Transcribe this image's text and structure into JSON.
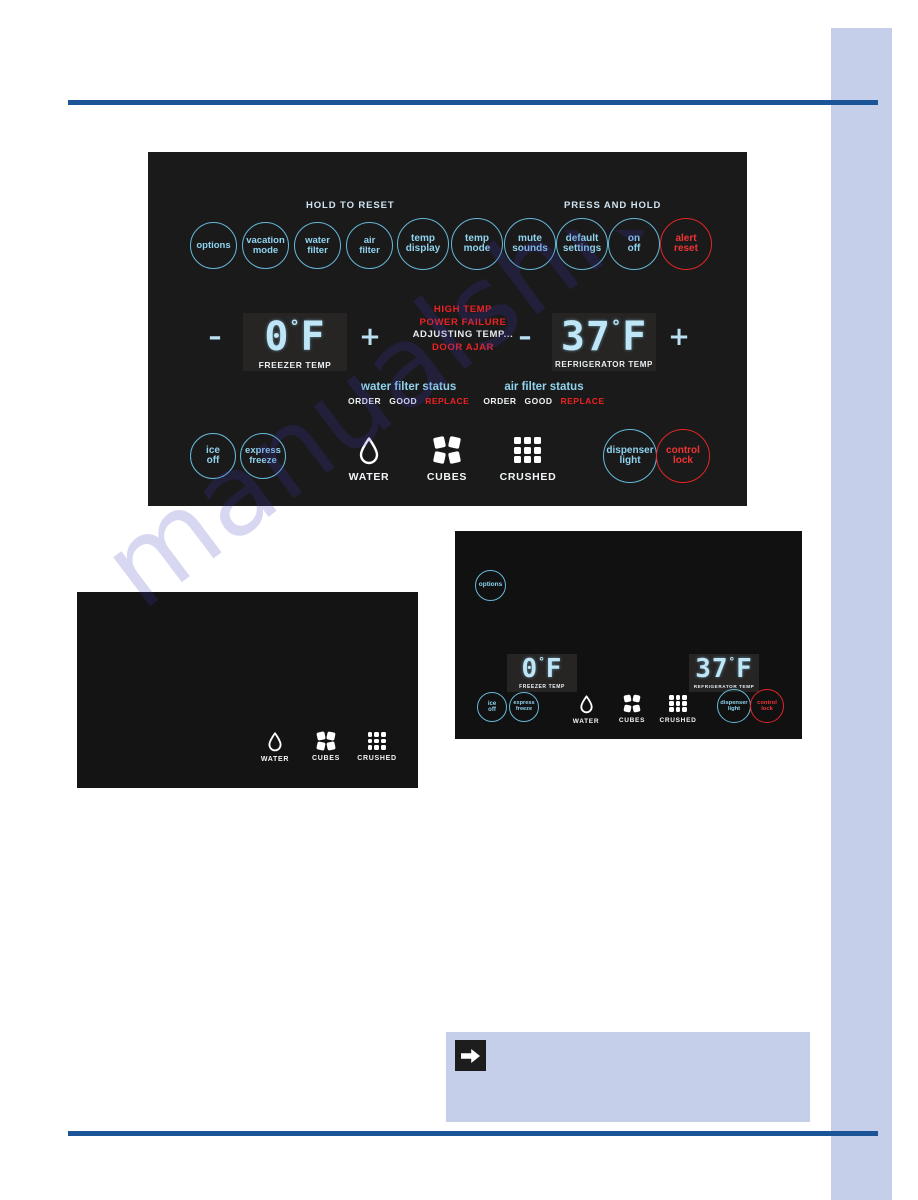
{
  "page": {
    "accent_rule_color": "#1b5497",
    "side_tab_color": "#c6cfe9",
    "watermark_text": "manualshive.com"
  },
  "main_panel": {
    "background_color": "#1b1a1a",
    "hints": {
      "hold_to_reset": "HOLD TO RESET",
      "press_and_hold": "PRESS AND HOLD"
    },
    "top_buttons": [
      {
        "id": "options",
        "lines": [
          "options"
        ],
        "color": "#8fd3ee",
        "style": "blue"
      },
      {
        "id": "vacation-mode",
        "lines": [
          "vacation",
          "mode"
        ],
        "color": "#8fd3ee",
        "style": "blue"
      },
      {
        "id": "water-filter",
        "lines": [
          "water",
          "filter"
        ],
        "color": "#8fd3ee",
        "style": "blue"
      },
      {
        "id": "air-filter",
        "lines": [
          "air",
          "filter"
        ],
        "color": "#8fd3ee",
        "style": "blue"
      },
      {
        "id": "temp-display",
        "lines": [
          "temp",
          "display"
        ],
        "color": "#8fd3ee",
        "style": "blue"
      },
      {
        "id": "temp-mode",
        "lines": [
          "temp",
          "mode"
        ],
        "color": "#8fd3ee",
        "style": "blue"
      },
      {
        "id": "mute-sounds",
        "lines": [
          "mute",
          "sounds"
        ],
        "color": "#8fd3ee",
        "style": "blue"
      },
      {
        "id": "default-settings",
        "lines": [
          "default",
          "settings"
        ],
        "color": "#8fd3ee",
        "style": "blue"
      },
      {
        "id": "on-off",
        "lines": [
          "on",
          "off"
        ],
        "color": "#8fd3ee",
        "style": "blue"
      },
      {
        "id": "alert-reset",
        "lines": [
          "alert",
          "reset"
        ],
        "color": "#f03434",
        "style": "red"
      }
    ],
    "freezer": {
      "minus": "–",
      "plus": "+",
      "value": "0",
      "degree": "°",
      "unit": "F",
      "caption": "FREEZER TEMP"
    },
    "refrigerator": {
      "minus": "–",
      "plus": "+",
      "value": "37",
      "degree": "°",
      "unit": "F",
      "caption": "REFRIGERATOR TEMP"
    },
    "alerts": [
      {
        "text": "HIGH TEMP",
        "color": "#ee2222",
        "tone": "red"
      },
      {
        "text": "POWER FAILURE",
        "color": "#ee2222",
        "tone": "red"
      },
      {
        "text": "ADJUSTING TEMP...",
        "color": "#e8eef2",
        "tone": "white"
      },
      {
        "text": "DOOR AJAR",
        "color": "#ee2222",
        "tone": "red"
      }
    ],
    "filter_status": [
      {
        "id": "water-filter-status",
        "title": "water filter status",
        "states": [
          {
            "label": "ORDER",
            "tone": "white"
          },
          {
            "label": "GOOD",
            "tone": "white"
          },
          {
            "label": "REPLACE",
            "tone": "red"
          }
        ]
      },
      {
        "id": "air-filter-status",
        "title": "air filter status",
        "states": [
          {
            "label": "ORDER",
            "tone": "white"
          },
          {
            "label": "GOOD",
            "tone": "white"
          },
          {
            "label": "REPLACE",
            "tone": "red"
          }
        ]
      }
    ],
    "bottom_buttons": [
      {
        "id": "ice-off",
        "lines": [
          "ice",
          "off"
        ],
        "style": "blue"
      },
      {
        "id": "express-freeze",
        "lines": [
          "express",
          "freeze"
        ],
        "style": "blue"
      },
      {
        "id": "dispenser-light",
        "lines": [
          "dispenser",
          "light"
        ],
        "style": "blue"
      },
      {
        "id": "control-lock",
        "lines": [
          "control",
          "lock"
        ],
        "style": "red"
      }
    ],
    "dispenser_options": [
      {
        "id": "water",
        "label": "WATER",
        "icon": "water-drop-icon"
      },
      {
        "id": "cubes",
        "label": "CUBES",
        "icon": "ice-cubes-icon"
      },
      {
        "id": "crushed",
        "label": "CRUSHED",
        "icon": "crushed-ice-icon"
      }
    ]
  },
  "secondary_panel": {
    "background_color": "#121111",
    "options_button": {
      "id": "options",
      "label": "options"
    },
    "freezer": {
      "value": "0",
      "degree": "°",
      "unit": "F",
      "caption": "FREEZER TEMP"
    },
    "refrigerator": {
      "value": "37",
      "degree": "°",
      "unit": "F",
      "caption": "REFRIGERATOR TEMP"
    },
    "bottom_buttons": [
      {
        "id": "ice-off",
        "lines": [
          "ice",
          "off"
        ],
        "style": "blue"
      },
      {
        "id": "express-freeze",
        "lines": [
          "express",
          "freeze"
        ],
        "style": "blue"
      },
      {
        "id": "dispenser-light",
        "lines": [
          "dispenser",
          "light"
        ],
        "style": "blue"
      },
      {
        "id": "control-lock",
        "lines": [
          "control",
          "lock"
        ],
        "style": "red"
      }
    ],
    "dispenser_options": [
      {
        "id": "water",
        "label": "WATER",
        "icon": "water-drop-icon"
      },
      {
        "id": "cubes",
        "label": "CUBES",
        "icon": "ice-cubes-icon"
      },
      {
        "id": "crushed",
        "label": "CRUSHED",
        "icon": "crushed-ice-icon"
      }
    ]
  },
  "dispenser_panel": {
    "background_color": "#151414",
    "dispenser_options": [
      {
        "id": "water",
        "label": "WATER",
        "icon": "water-drop-icon"
      },
      {
        "id": "cubes",
        "label": "CUBES",
        "icon": "ice-cubes-icon"
      },
      {
        "id": "crushed",
        "label": "CRUSHED",
        "icon": "crushed-ice-icon"
      }
    ]
  },
  "note": {
    "icon": "arrow-right-icon",
    "text": ""
  }
}
